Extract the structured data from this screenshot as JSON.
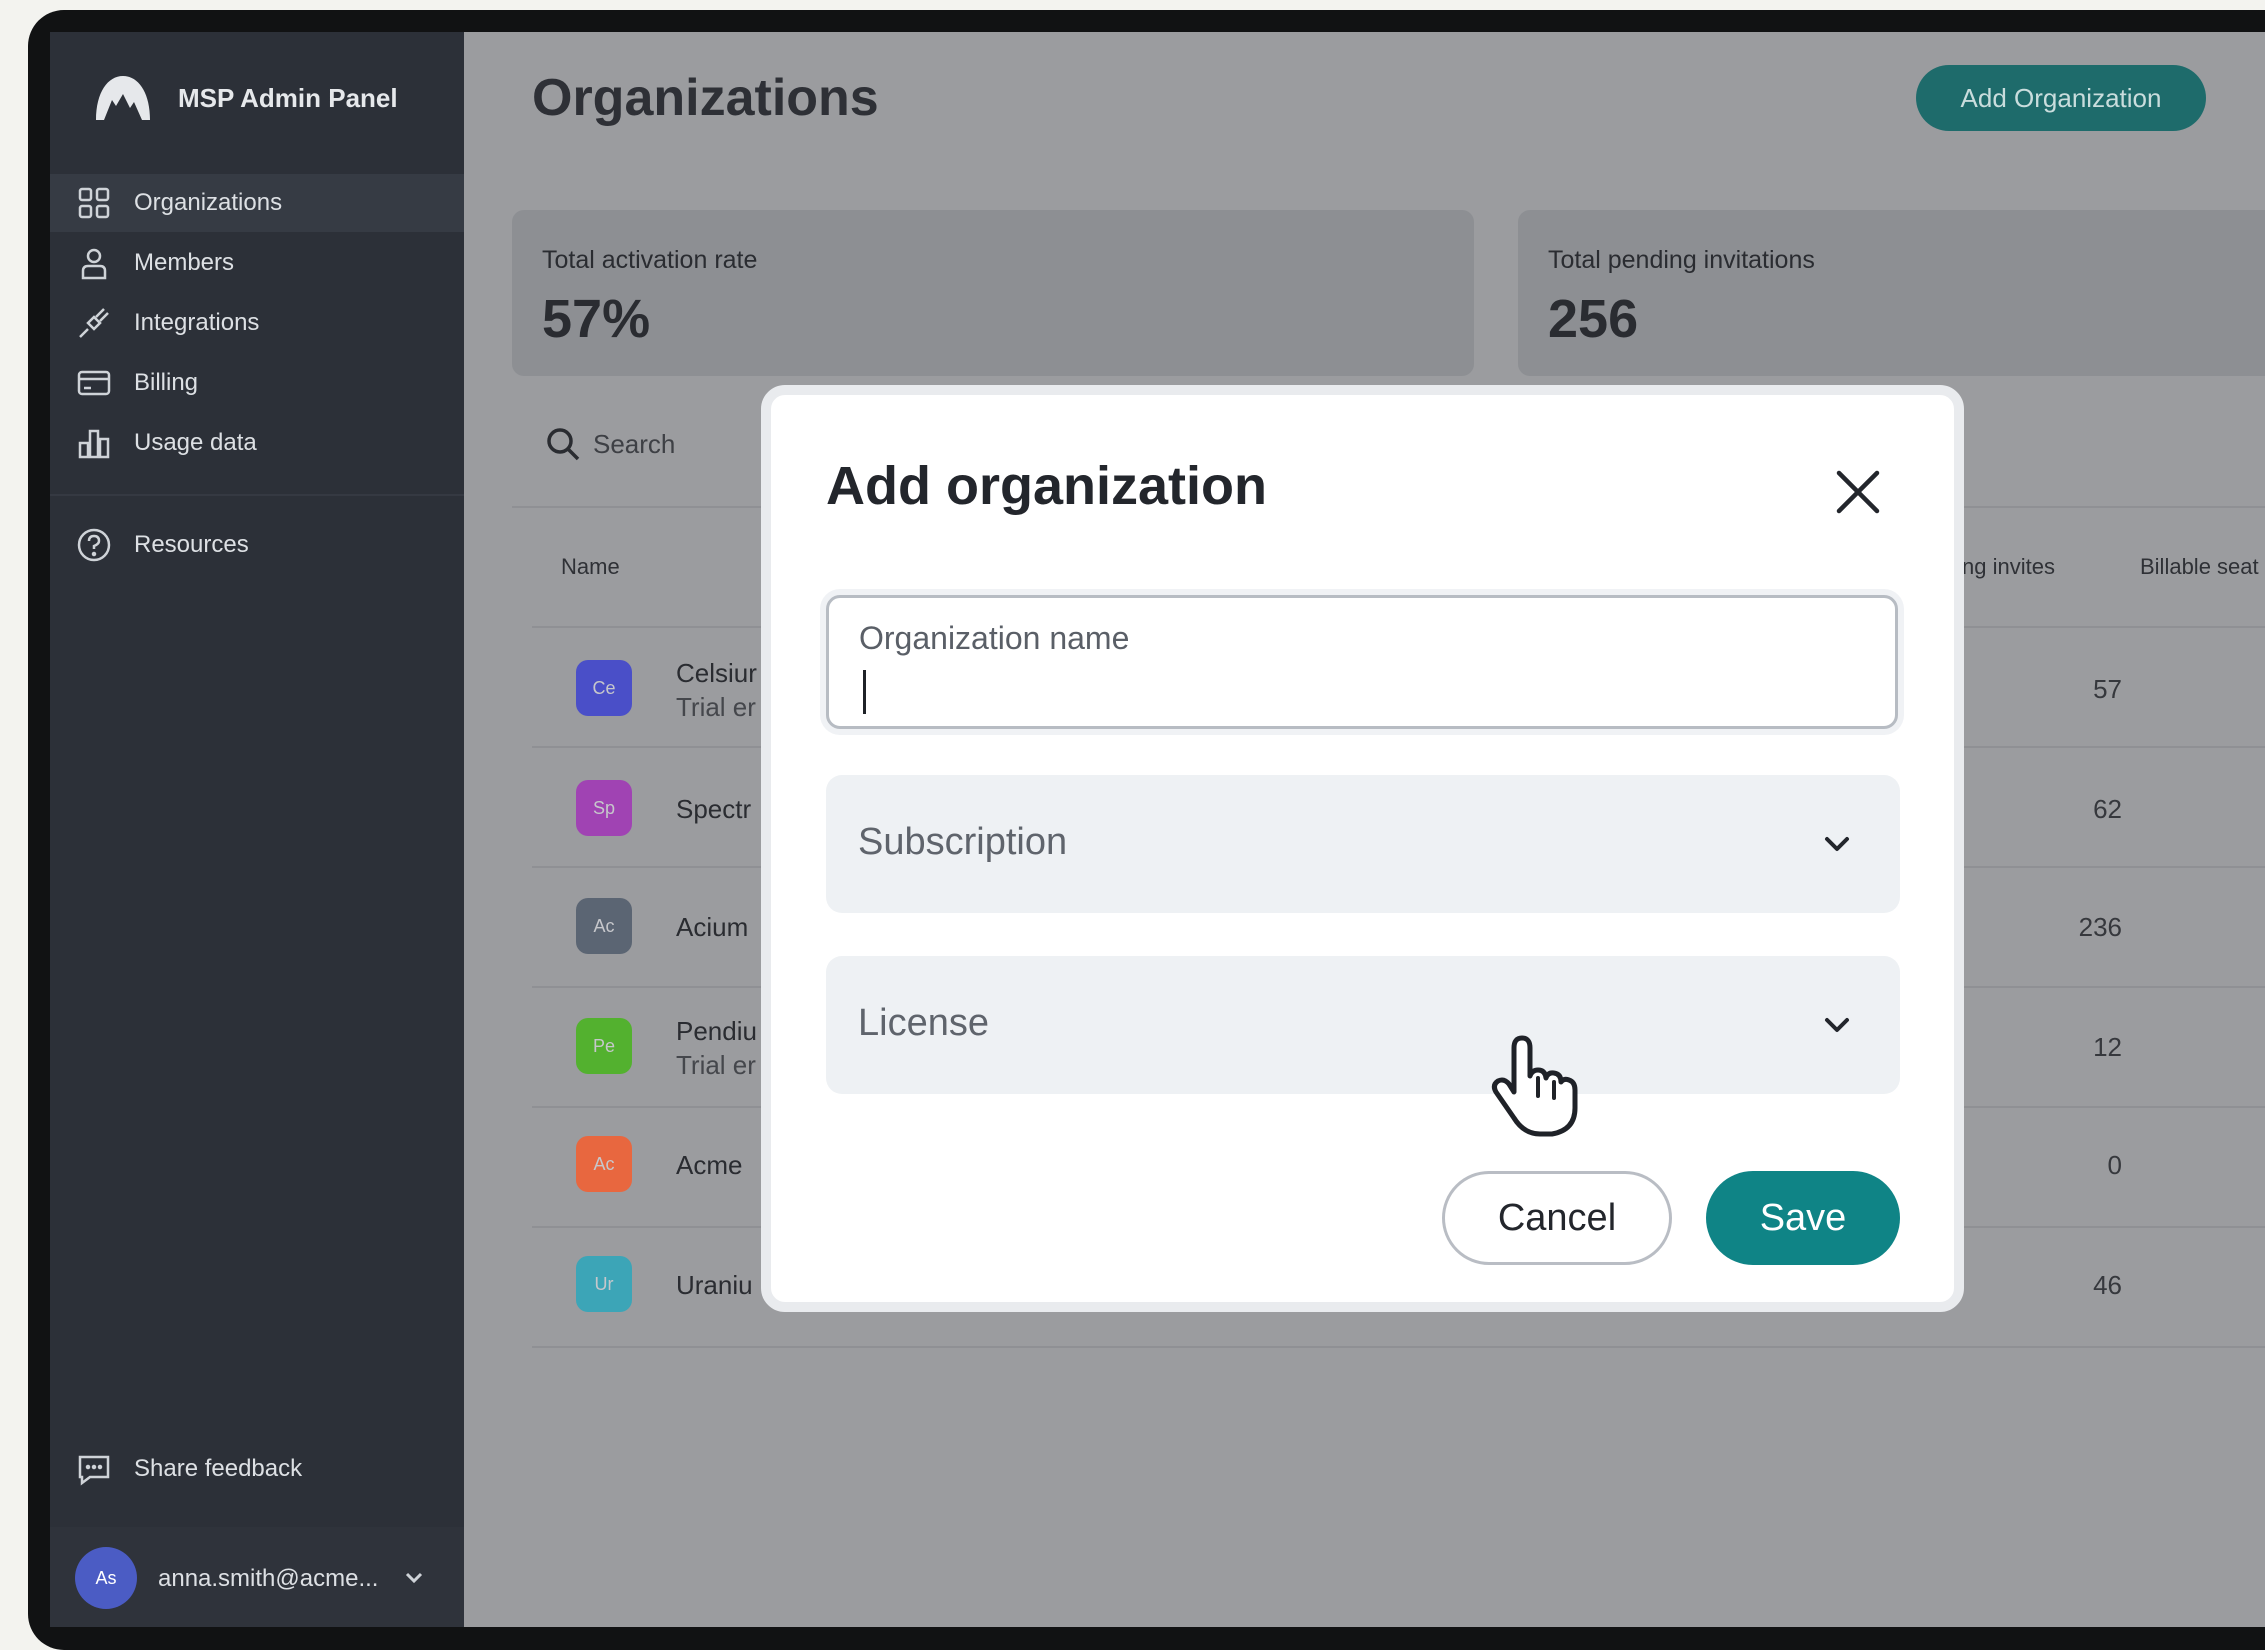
{
  "sidebar": {
    "brand": "MSP Admin Panel",
    "nav": [
      {
        "label": "Organizations",
        "icon": "grid-icon",
        "active": true
      },
      {
        "label": "Members",
        "icon": "person-icon"
      },
      {
        "label": "Integrations",
        "icon": "plug-icon"
      },
      {
        "label": "Billing",
        "icon": "card-icon"
      },
      {
        "label": "Usage data",
        "icon": "bar-chart-icon"
      }
    ],
    "resources": "Resources",
    "feedback": "Share feedback",
    "user": {
      "initials": "As",
      "email": "anna.smith@acme..."
    }
  },
  "main": {
    "title": "Organizations",
    "add_button": "Add Organization",
    "stats": [
      {
        "label": "Total activation rate",
        "value": "57%"
      },
      {
        "label": "Total pending invitations",
        "value": "256"
      }
    ],
    "search_placeholder": "Search",
    "columns": {
      "name": "Name",
      "pending": "ng invites",
      "billable": "Billable seat"
    },
    "rows": [
      {
        "initials": "Ce",
        "name": "Celsiur",
        "sub": "Trial er",
        "pending": "57",
        "color": "#4a4fc8"
      },
      {
        "initials": "Sp",
        "name": "Spectr",
        "sub": "",
        "pending": "62",
        "color": "#a043b3"
      },
      {
        "initials": "Ac",
        "name": "Acium",
        "sub": "",
        "pending": "236",
        "color": "#5b6573"
      },
      {
        "initials": "Pe",
        "name": "Pendiu",
        "sub": "Trial er",
        "pending": "12",
        "color": "#53b12f"
      },
      {
        "initials": "Ac",
        "name": "Acme",
        "sub": "",
        "pending": "0",
        "color": "#e8673f"
      },
      {
        "initials": "Ur",
        "name": "Uraniu",
        "sub": "",
        "pending": "46",
        "color": "#3ca5b7"
      }
    ]
  },
  "modal": {
    "title": "Add organization",
    "org_name_label": "Organization name",
    "subscription": "Subscription",
    "license": "License",
    "cancel": "Cancel",
    "save": "Save"
  }
}
